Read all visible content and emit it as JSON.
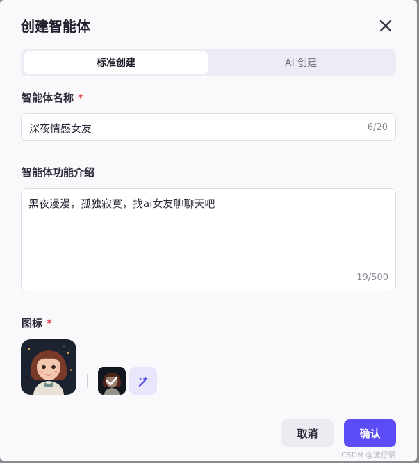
{
  "dialog": {
    "title": "创建智能体",
    "close_icon": "close-icon"
  },
  "tabs": [
    {
      "label": "标准创建",
      "active": true
    },
    {
      "label": "AI 创建",
      "active": false
    }
  ],
  "fields": {
    "name": {
      "label": "智能体名称",
      "required_mark": "*",
      "value": "深夜情感女友",
      "counter": "6/20"
    },
    "description": {
      "label": "智能体功能介绍",
      "value": "黑夜漫漫，孤独寂寞，找ai女友聊聊天吧",
      "counter": "19/500"
    },
    "icon": {
      "label": "图标",
      "required_mark": "*",
      "preview": "avatar-image",
      "options": [
        {
          "name": "avatar-thumbnail",
          "selected": true
        },
        {
          "name": "ai-generate-sparkle-icon",
          "selected": false
        }
      ]
    }
  },
  "buttons": {
    "cancel": "取消",
    "confirm": "确认"
  },
  "watermark": "CSDN @波仔情",
  "colors": {
    "accent": "#5b4cf5",
    "required": "#e5484d",
    "dialog_bg": "#f9f9fc"
  }
}
